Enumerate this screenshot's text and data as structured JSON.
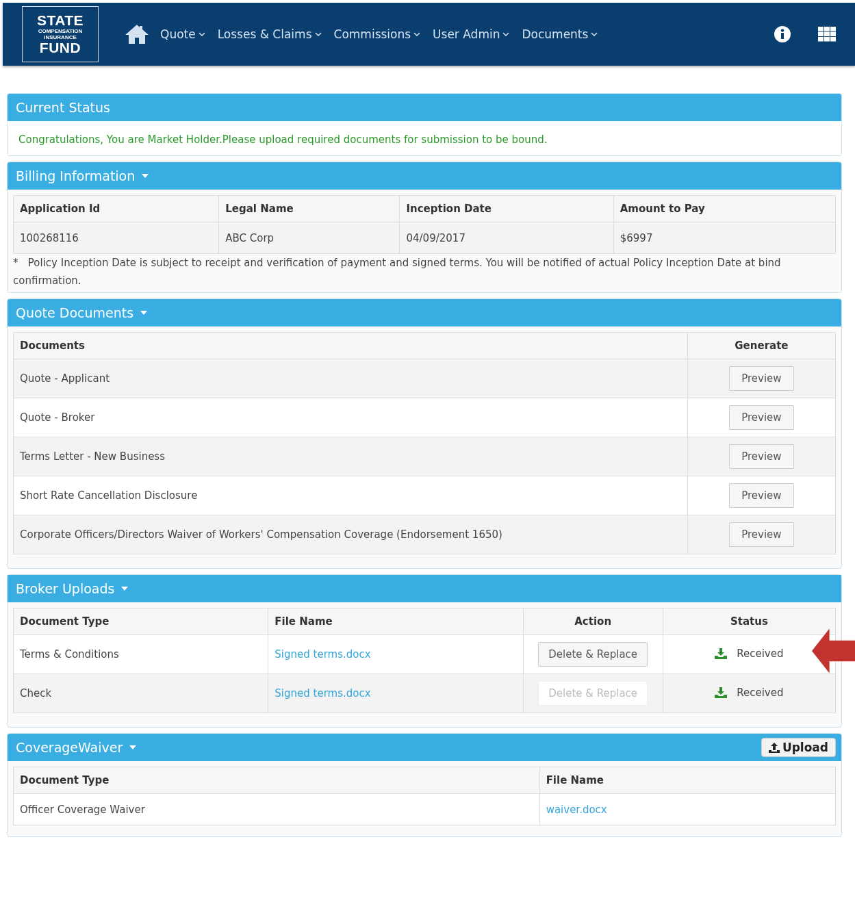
{
  "header": {
    "logo": {
      "top": "STATE",
      "middle_1": "COMPENSATION",
      "middle_2": "INSURANCE",
      "bottom": "FUND"
    },
    "nav": [
      {
        "label": "Quote"
      },
      {
        "label": "Losses & Claims"
      },
      {
        "label": "Commissions"
      },
      {
        "label": "User Admin"
      },
      {
        "label": "Documents"
      }
    ]
  },
  "current_status": {
    "title": "Current Status",
    "message": "Congratulations, You are Market Holder.Please upload required documents for submission to be bound."
  },
  "billing": {
    "title": "Billing Information",
    "columns": [
      "Application Id",
      "Legal Name",
      "Inception Date",
      "Amount to Pay"
    ],
    "row": [
      "100268116",
      "ABC Corp",
      "04/09/2017",
      "$6997"
    ],
    "note_mark": "*",
    "note": "Policy Inception Date is subject to receipt and verification of payment and signed terms. You will be notified of actual Policy Inception Date at bind confirmation."
  },
  "quote_documents": {
    "title": "Quote Documents",
    "columns": [
      "Documents",
      "Generate"
    ],
    "rows": [
      {
        "document": "Quote - Applicant",
        "button": "Preview"
      },
      {
        "document": "Quote - Broker",
        "button": "Preview"
      },
      {
        "document": "Terms Letter - New Business",
        "button": "Preview"
      },
      {
        "document": "Short Rate Cancellation Disclosure",
        "button": "Preview"
      },
      {
        "document": "Corporate Officers/Directors Waiver of Workers' Compensation Coverage (Endorsement 1650)",
        "button": "Preview"
      }
    ]
  },
  "broker_uploads": {
    "title": "Broker Uploads",
    "columns": [
      "Document Type",
      "File Name",
      "Action",
      "Status"
    ],
    "rows": [
      {
        "document_type": "Terms & Conditions",
        "file_name": "Signed terms.docx",
        "action": "Delete & Replace",
        "disabled": false,
        "status": "Received",
        "highlighted": true
      },
      {
        "document_type": "Check",
        "file_name": "Signed terms.docx",
        "action": "Delete & Replace",
        "disabled": true,
        "status": "Received",
        "highlighted": false
      }
    ]
  },
  "coverage_waiver": {
    "title": "CoverageWaiver",
    "upload_button": "Upload",
    "columns": [
      "Document Type",
      "File Name"
    ],
    "rows": [
      {
        "document_type": "Officer Coverage Waiver",
        "file_name": "waiver.docx"
      }
    ]
  }
}
